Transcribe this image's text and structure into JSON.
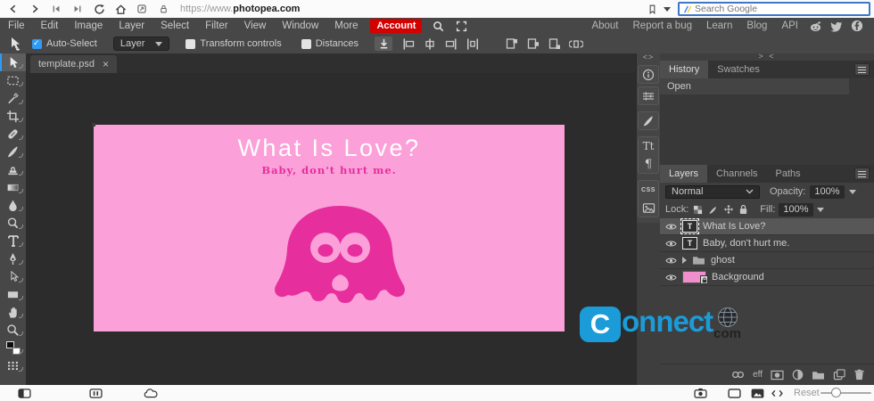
{
  "colors": {
    "accent": "#2f9bf4",
    "red": "#d40000",
    "pink": "#fba0d8",
    "magenta": "#e62e9d",
    "wmblue": "#1b9cd8"
  },
  "browser_bar": {
    "url_prefix": "https://www.",
    "url_domain": "photopea.com",
    "search": {
      "placeholder": "Search Google"
    },
    "icons": [
      "back-icon",
      "forward-icon",
      "skip-back-icon",
      "skip-forward-icon",
      "reload-icon",
      "home-icon",
      "page-action-icon",
      "lock-icon",
      "bookmark-icon",
      "caret-down-icon",
      "search-engine-icon"
    ]
  },
  "menu_bar": {
    "items": [
      "File",
      "Edit",
      "Image",
      "Layer",
      "Select",
      "Filter",
      "View",
      "Window",
      "More"
    ],
    "account_label": "Account",
    "icons": [
      "search-icon",
      "fullscreen-icon",
      "reddit-icon",
      "twitter-icon",
      "facebook-icon"
    ],
    "links": [
      "About",
      "Report a bug",
      "Learn",
      "Blog",
      "API"
    ]
  },
  "options_bar": {
    "auto_select": {
      "label": "Auto-Select",
      "checked": true
    },
    "target_select": {
      "value": "Layer"
    },
    "transform_controls": {
      "label": "Transform controls",
      "checked": false
    },
    "distances": {
      "label": "Distances",
      "checked": false
    },
    "icons": [
      "move-cursor-icon",
      "commit-icon",
      "align-left-icon",
      "align-center-h-icon",
      "align-right-icon",
      "distribute-h-icon",
      "align-top-icon",
      "align-middle-icon",
      "align-bottom-icon",
      "distribute-v-icon"
    ]
  },
  "document_tabs": {
    "active_tab": "template.psd",
    "close_glyph": "×"
  },
  "toolbar_tools": [
    "move-tool",
    "rect-select-tool",
    "magic-wand-tool",
    "crop-tool",
    "healing-brush-tool",
    "brush-tool",
    "clone-stamp-tool",
    "gradient-tool",
    "blur-tool",
    "dodge-tool",
    "type-tool",
    "pen-tool",
    "direct-select-tool",
    "rect-shape-tool",
    "hand-tool",
    "zoom-tool",
    "color-swatches",
    "toolbar-grid"
  ],
  "canvas": {
    "artboard": {
      "title": "What Is Love?",
      "subtitle": "Baby, don't hurt me.",
      "background_color": "#fba0d8",
      "title_color": "#ffffff",
      "accent_color": "#e62e9d"
    }
  },
  "watermark": {
    "initial": "C",
    "rest": "onnect",
    "tld": "com"
  },
  "side_strip": {
    "collapse_label": "<>",
    "char_label": "Tt",
    "paragraph_label": "¶",
    "css_label": "CSS",
    "icons": [
      "info-icon",
      "adjust-icon",
      "brush-panel-icon",
      "character-panel-icon",
      "paragraph-panel-icon",
      "css-panel-icon",
      "image-panel-icon"
    ]
  },
  "right_panel": {
    "collapse_label": "> <",
    "history": {
      "tabs": [
        "History",
        "Swatches"
      ],
      "active_tab": "History",
      "entries": [
        "Open"
      ]
    },
    "layers": {
      "tabs": [
        "Layers",
        "Channels",
        "Paths"
      ],
      "active_tab": "Layers",
      "blend_mode": "Normal",
      "opacity_label": "Opacity:",
      "opacity_value": "100%",
      "lock_label": "Lock:",
      "fill_label": "Fill:",
      "fill_value": "100%",
      "type_thumb_glyph": "T",
      "rows": [
        {
          "name": "What Is Love?",
          "type": "text",
          "selected": true
        },
        {
          "name": "Baby, don't hurt me.",
          "type": "text",
          "selected": false
        },
        {
          "name": "ghost",
          "type": "group",
          "selected": false
        },
        {
          "name": "Background",
          "type": "image",
          "locked": true,
          "selected": false
        }
      ],
      "footer_effects_label": "eff",
      "footer_icons": [
        "link-icon",
        "effects-label",
        "mask-icon",
        "adjustment-icon",
        "folder-icon",
        "new-layer-icon",
        "delete-icon"
      ]
    }
  },
  "bottom_bar": {
    "reset_label": "Reset",
    "zoom_slider_value": 30,
    "icons": [
      "sidebar-toggle-icon",
      "columns-icon",
      "cloud-icon",
      "camera-icon",
      "window-icon",
      "image-icon",
      "resize-arrows-icon"
    ]
  }
}
